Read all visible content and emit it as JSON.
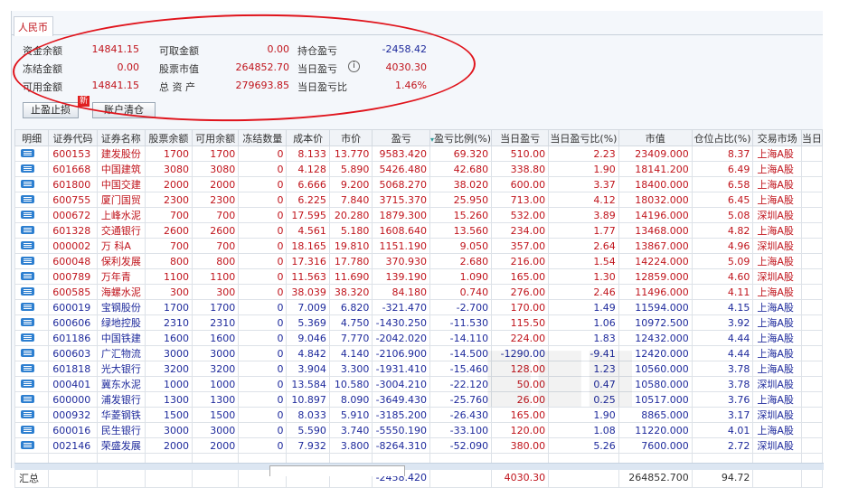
{
  "tab": "人民币",
  "summary": {
    "rows": [
      [
        {
          "label": "资金余额",
          "value": "14841.15"
        },
        {
          "label": "可取金额",
          "value": "0.00"
        },
        {
          "label": "持仓盈亏",
          "value": "-2458.42",
          "color": "blue"
        }
      ],
      [
        {
          "label": "冻结金额",
          "value": "0.00"
        },
        {
          "label": "股票市值",
          "value": "264852.70"
        },
        {
          "label": "当日盈亏",
          "value": "4030.30",
          "color": "red",
          "info": true
        }
      ],
      [
        {
          "label": "可用金额",
          "value": "14841.15"
        },
        {
          "label": "总 资 产",
          "value": "279693.85"
        },
        {
          "label": "当日盈亏比",
          "value": "1.46%",
          "color": "red"
        }
      ]
    ]
  },
  "buttons": {
    "stop": "止盈止损",
    "new_badge": "新",
    "clear": "账户清仓"
  },
  "columns": [
    "明细",
    "证券代码",
    "证券名称",
    "股票余额",
    "可用余额",
    "冻结数量",
    "成本价",
    "市价",
    "盈亏",
    "盈亏比例(%)",
    "当日盈亏",
    "当日盈亏比(%)",
    "市值",
    "仓位占比(%)",
    "交易市场",
    "当日"
  ],
  "rows": [
    [
      "600153",
      "建发股份",
      "1700",
      "1700",
      "0",
      "8.133",
      "13.770",
      "9583.420",
      "69.320",
      "510.00",
      "2.23",
      "23409.000",
      "8.37",
      "上海A股"
    ],
    [
      "601668",
      "中国建筑",
      "3080",
      "3080",
      "0",
      "4.128",
      "5.890",
      "5426.480",
      "42.680",
      "338.80",
      "1.90",
      "18141.200",
      "6.49",
      "上海A股"
    ],
    [
      "601800",
      "中国交建",
      "2000",
      "2000",
      "0",
      "6.666",
      "9.200",
      "5068.270",
      "38.020",
      "600.00",
      "3.37",
      "18400.000",
      "6.58",
      "上海A股"
    ],
    [
      "600755",
      "厦门国贸",
      "2300",
      "2300",
      "0",
      "6.225",
      "7.840",
      "3715.370",
      "25.950",
      "713.00",
      "4.12",
      "18032.000",
      "6.45",
      "上海A股"
    ],
    [
      "000672",
      "上峰水泥",
      "700",
      "700",
      "0",
      "17.595",
      "20.280",
      "1879.300",
      "15.260",
      "532.00",
      "3.89",
      "14196.000",
      "5.08",
      "深圳A股"
    ],
    [
      "601328",
      "交通银行",
      "2600",
      "2600",
      "0",
      "4.561",
      "5.180",
      "1608.640",
      "13.560",
      "234.00",
      "1.77",
      "13468.000",
      "4.82",
      "上海A股"
    ],
    [
      "000002",
      "万 科A",
      "700",
      "700",
      "0",
      "18.165",
      "19.810",
      "1151.190",
      "9.050",
      "357.00",
      "2.64",
      "13867.000",
      "4.96",
      "深圳A股"
    ],
    [
      "600048",
      "保利发展",
      "800",
      "800",
      "0",
      "17.316",
      "17.780",
      "370.930",
      "2.680",
      "216.00",
      "1.54",
      "14224.000",
      "5.09",
      "上海A股"
    ],
    [
      "000789",
      "万年青",
      "1100",
      "1100",
      "0",
      "11.563",
      "11.690",
      "139.190",
      "1.090",
      "165.00",
      "1.30",
      "12859.000",
      "4.60",
      "深圳A股"
    ],
    [
      "600585",
      "海螺水泥",
      "300",
      "300",
      "0",
      "38.039",
      "38.320",
      "84.180",
      "0.740",
      "276.00",
      "2.46",
      "11496.000",
      "4.11",
      "上海A股"
    ],
    [
      "600019",
      "宝钢股份",
      "1700",
      "1700",
      "0",
      "7.009",
      "6.820",
      "-321.470",
      "-2.700",
      "170.00",
      "1.49",
      "11594.000",
      "4.15",
      "上海A股"
    ],
    [
      "600606",
      "绿地控股",
      "2310",
      "2310",
      "0",
      "5.369",
      "4.750",
      "-1430.250",
      "-11.530",
      "115.50",
      "1.06",
      "10972.500",
      "3.92",
      "上海A股"
    ],
    [
      "601186",
      "中国铁建",
      "1600",
      "1600",
      "0",
      "9.046",
      "7.770",
      "-2042.020",
      "-14.110",
      "224.00",
      "1.83",
      "12432.000",
      "4.44",
      "上海A股"
    ],
    [
      "600603",
      "广汇物流",
      "3000",
      "3000",
      "0",
      "4.842",
      "4.140",
      "-2106.900",
      "-14.500",
      "-1290.00",
      "-9.41",
      "12420.000",
      "4.44",
      "上海A股"
    ],
    [
      "601818",
      "光大银行",
      "3200",
      "3200",
      "0",
      "3.904",
      "3.300",
      "-1931.410",
      "-15.460",
      "128.00",
      "1.23",
      "10560.000",
      "3.78",
      "上海A股"
    ],
    [
      "000401",
      "冀东水泥",
      "1000",
      "1000",
      "0",
      "13.584",
      "10.580",
      "-3004.210",
      "-22.120",
      "50.00",
      "0.47",
      "10580.000",
      "3.78",
      "深圳A股"
    ],
    [
      "600000",
      "浦发银行",
      "1300",
      "1300",
      "0",
      "10.897",
      "8.090",
      "-3649.430",
      "-25.760",
      "26.00",
      "0.25",
      "10517.000",
      "3.76",
      "上海A股"
    ],
    [
      "000932",
      "华菱钢铁",
      "1500",
      "1500",
      "0",
      "8.033",
      "5.910",
      "-3185.200",
      "-26.430",
      "165.00",
      "1.90",
      "8865.000",
      "3.17",
      "深圳A股"
    ],
    [
      "600016",
      "民生银行",
      "3000",
      "3000",
      "0",
      "5.590",
      "3.740",
      "-5550.190",
      "-33.100",
      "120.00",
      "1.08",
      "11220.000",
      "4.01",
      "上海A股"
    ],
    [
      "002146",
      "荣盛发展",
      "2000",
      "2000",
      "0",
      "7.932",
      "3.800",
      "-8264.310",
      "-52.090",
      "380.00",
      "5.26",
      "7600.000",
      "2.72",
      "深圳A股"
    ]
  ],
  "total": {
    "label": "汇总",
    "pnl": "-2458.420",
    "day_pnl": "4030.30",
    "market_value": "264852.700",
    "position": "94.72"
  }
}
